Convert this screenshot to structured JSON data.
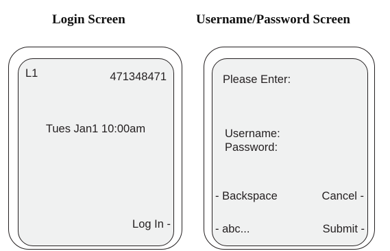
{
  "headings": {
    "login": "Login Screen",
    "credentials": "Username/Password Screen"
  },
  "login_screen": {
    "line_label": "L1",
    "number": "471348471",
    "datetime": "Tues Jan1 10:00am",
    "softkey_login": "Log In -"
  },
  "credentials_screen": {
    "prompt": "Please Enter:",
    "username_label": "Username:",
    "password_label": "Password:",
    "softkey_backspace": "- Backspace",
    "softkey_cancel": "Cancel -",
    "softkey_abc": "- abc...",
    "softkey_submit": "Submit -"
  }
}
